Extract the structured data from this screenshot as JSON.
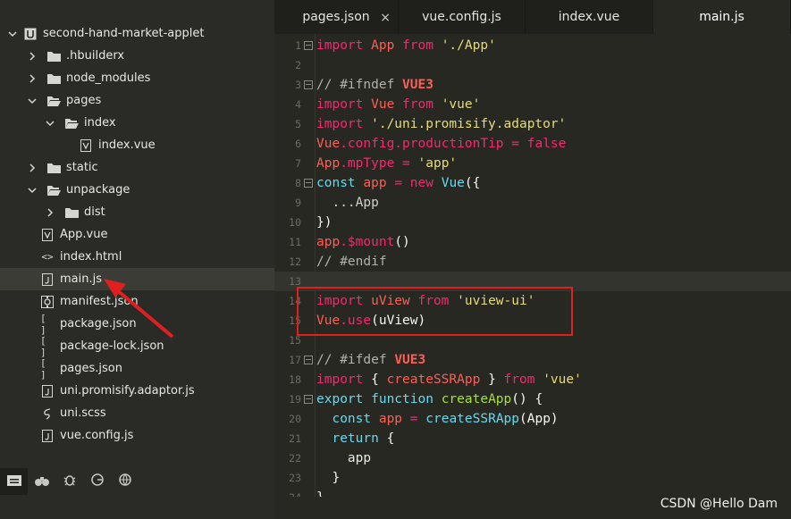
{
  "project": {
    "root": "second-hand-market-applet",
    "items": [
      {
        "label": ".hbuilderx"
      },
      {
        "label": "node_modules"
      },
      {
        "label": "pages"
      },
      {
        "label": "index"
      },
      {
        "label": "index.vue"
      },
      {
        "label": "static"
      },
      {
        "label": "unpackage"
      },
      {
        "label": "dist"
      },
      {
        "label": "App.vue"
      },
      {
        "label": "index.html"
      },
      {
        "label": "main.js"
      },
      {
        "label": "manifest.json"
      },
      {
        "label": "package.json"
      },
      {
        "label": "package-lock.json"
      },
      {
        "label": "pages.json"
      },
      {
        "label": "uni.promisify.adaptor.js"
      },
      {
        "label": "uni.scss"
      },
      {
        "label": "vue.config.js"
      }
    ]
  },
  "tabs": [
    {
      "label": "pages.json",
      "close": "×"
    },
    {
      "label": "vue.config.js"
    },
    {
      "label": "index.vue"
    },
    {
      "label": "main.js"
    }
  ],
  "code": {
    "l1": {
      "n": "1",
      "a": "import ",
      "b": "App",
      "c": " from ",
      "d": "'./App'"
    },
    "l2": {
      "n": "2"
    },
    "l3": {
      "n": "3",
      "a": "// #ifndef ",
      "b": "VUE3"
    },
    "l4": {
      "n": "4",
      "a": "import ",
      "b": "Vue",
      "c": " from ",
      "d": "'vue'"
    },
    "l5": {
      "n": "5",
      "a": "import ",
      "b": "'./uni.promisify.adaptor'"
    },
    "l6": {
      "n": "6",
      "a": "Vue",
      "b": ".config.productionTip",
      "c": " = ",
      "d": "false"
    },
    "l7": {
      "n": "7",
      "a": "App",
      "b": ".mpType",
      "c": " = ",
      "d": "'app'"
    },
    "l8": {
      "n": "8",
      "a": "const ",
      "b": "app",
      "c": " = ",
      "d": "new ",
      "e": "Vue",
      "f": "({"
    },
    "l9": {
      "n": "9",
      "a": "  ...App"
    },
    "l10": {
      "n": "10",
      "a": "})"
    },
    "l11": {
      "n": "11",
      "a": "app",
      "b": ".$mount",
      "c": "()"
    },
    "l12": {
      "n": "12",
      "a": "// #endif"
    },
    "l13": {
      "n": "13"
    },
    "l14": {
      "n": "14",
      "a": "import ",
      "b": "uView",
      "c": " from ",
      "d": "'uview-ui'"
    },
    "l15a": {
      "n": "15",
      "a": "Vue",
      "b": ".use",
      "c": "(uView)"
    },
    "l15b": {
      "n": "15"
    },
    "l17": {
      "n": "17",
      "a": "// #ifdef ",
      "b": "VUE3"
    },
    "l18": {
      "n": "18",
      "a": "import ",
      "b": "{ ",
      "c": "createSSRApp",
      "d": " } ",
      "e": "from ",
      "f": "'vue'"
    },
    "l19": {
      "n": "19",
      "a": "export ",
      "b": "function ",
      "c": "createApp",
      "d": "() {"
    },
    "l20": {
      "n": "20",
      "a": "  const ",
      "b": "app",
      "c": " = ",
      "d": "createSSRApp",
      "e": "(App)"
    },
    "l21": {
      "n": "21",
      "a": "  return ",
      "b": "{"
    },
    "l22": {
      "n": "22",
      "a": "    app"
    },
    "l23": {
      "n": "23",
      "a": "  }"
    },
    "l24": {
      "n": "24",
      "a": "}"
    }
  },
  "watermark": "CSDN @Hello Dam",
  "colors": {
    "annotation": "#e02020",
    "keyword": "#f92672",
    "string": "#e6db74",
    "function": "#a6e22e"
  }
}
